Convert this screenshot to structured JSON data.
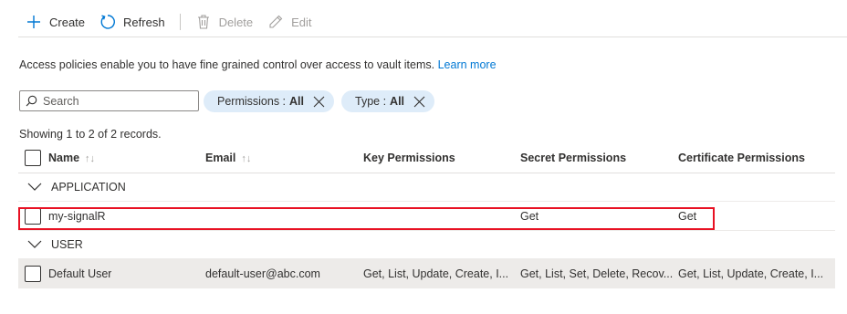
{
  "toolbar": {
    "create_label": "Create",
    "refresh_label": "Refresh",
    "delete_label": "Delete",
    "edit_label": "Edit"
  },
  "description": {
    "text": "Access policies enable you to have fine grained control over access to vault items.",
    "link_label": "Learn more"
  },
  "search": {
    "placeholder": "Search",
    "value": ""
  },
  "filters": [
    {
      "label": "Permissions :",
      "value": "All"
    },
    {
      "label": "Type :",
      "value": "All"
    }
  ],
  "records_text": "Showing 1 to 2 of 2 records.",
  "table": {
    "headers": {
      "name": "Name",
      "email": "Email",
      "key": "Key Permissions",
      "secret": "Secret Permissions",
      "cert": "Certificate Permissions"
    },
    "groups": [
      {
        "label": "APPLICATION",
        "rows": [
          {
            "name": "my-signalR",
            "email": "",
            "key": "",
            "secret": "Get",
            "cert": "Get"
          }
        ]
      },
      {
        "label": "USER",
        "rows": [
          {
            "name": "Default User",
            "email": "default-user@abc.com",
            "key": "Get, List, Update, Create, I...",
            "secret": "Get, List, Set, Delete, Recov...",
            "cert": "Get, List, Update, Create, I..."
          }
        ]
      }
    ]
  },
  "colors": {
    "accent": "#0078d4",
    "pill_bg": "#deecf9",
    "highlight": "#e81123",
    "selected_row": "#edebe9"
  }
}
